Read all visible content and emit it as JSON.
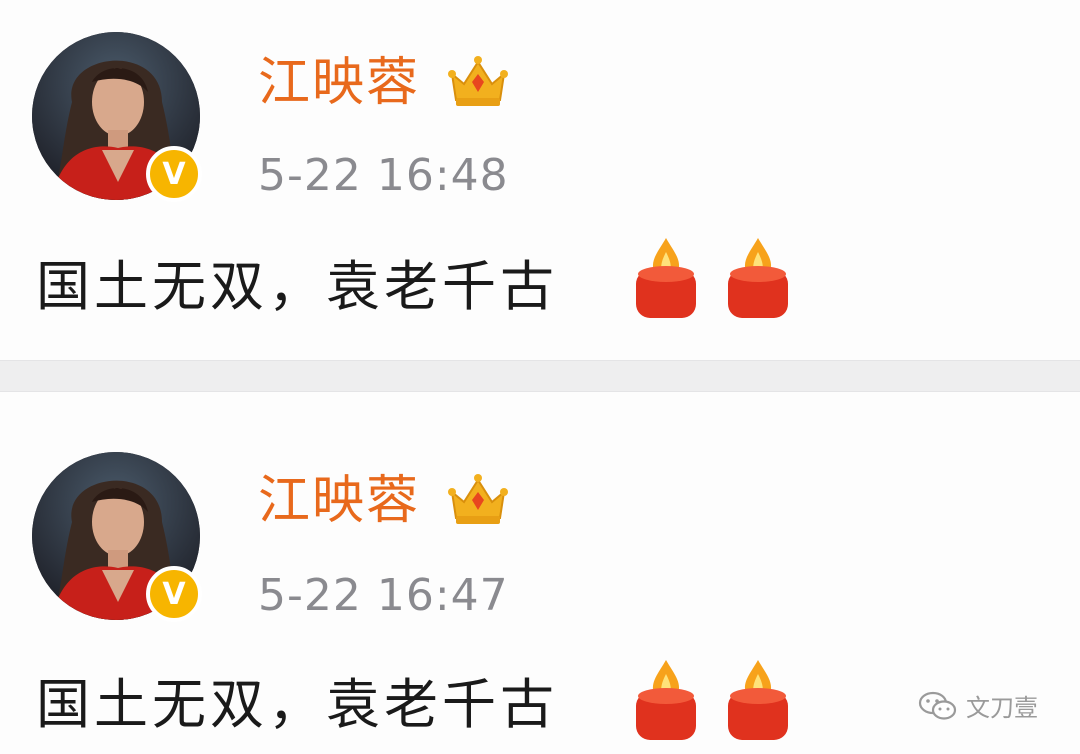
{
  "posts": [
    {
      "username": "江映蓉",
      "timestamp": "5-22 16:48",
      "content": "国土无双，袁老千古",
      "verified_badge": "V",
      "emoji": [
        "candle-icon",
        "candle-icon"
      ]
    },
    {
      "username": "江映蓉",
      "timestamp": "5-22 16:47",
      "content": "国土无双，袁老千古",
      "verified_badge": "V",
      "emoji": [
        "candle-icon",
        "candle-icon"
      ]
    }
  ],
  "watermark": {
    "text": "文刀壹",
    "icon": "wechat-icon"
  },
  "colors": {
    "username": "#e8691c",
    "timestamp": "#8a8a8f",
    "content": "#1a1a1a",
    "verified": "#f7b500",
    "candle": "#e0321e",
    "flame": "#f7a21b",
    "separator": "#eeeeef"
  }
}
